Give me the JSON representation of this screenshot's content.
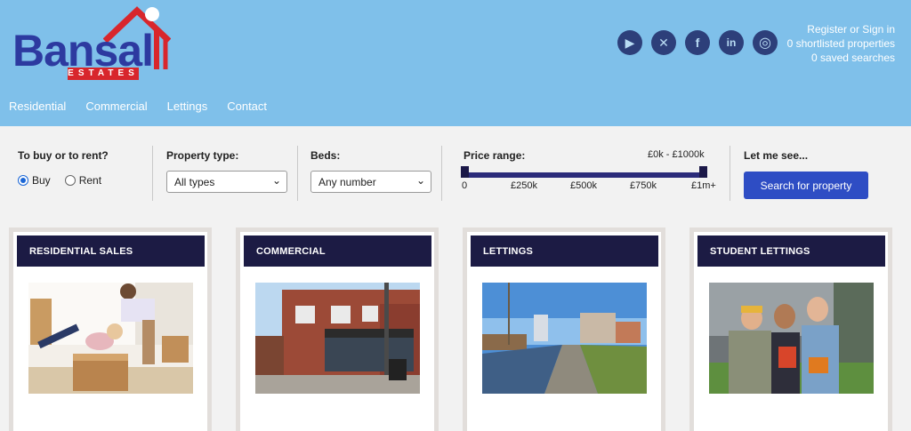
{
  "logo": {
    "wordmark": "Bansal",
    "subtitle": "ESTATES"
  },
  "social": [
    {
      "icon": "youtube-icon",
      "glyph": "▶"
    },
    {
      "icon": "x-icon",
      "glyph": "✕"
    },
    {
      "icon": "facebook-icon",
      "glyph": "f"
    },
    {
      "icon": "linkedin-icon",
      "glyph": "in"
    },
    {
      "icon": "instagram-icon",
      "glyph": "◎"
    }
  ],
  "account": {
    "register": "Register or Sign in",
    "shortlisted": "0 shortlisted properties",
    "saved": "0 saved searches"
  },
  "nav": [
    "Residential",
    "Commercial",
    "Lettings",
    "Contact"
  ],
  "search": {
    "buy_rent_label": "To buy or to rent?",
    "buy": "Buy",
    "rent": "Rent",
    "property_type_label": "Property type:",
    "property_type_value": "All types",
    "beds_label": "Beds:",
    "beds_value": "Any number",
    "price_label": "Price range:",
    "price_value": "£0k - £1000k",
    "ticks": [
      "0",
      "£250k",
      "£500k",
      "£750k",
      "£1m+"
    ],
    "let_me_see": "Let me see...",
    "button": "Search for property"
  },
  "cards": [
    {
      "title": "RESIDENTIAL SALES"
    },
    {
      "title": "COMMERCIAL"
    },
    {
      "title": "LETTINGS"
    },
    {
      "title": "STUDENT LETTINGS"
    }
  ],
  "colors": {
    "header": "#7fc0ea",
    "navy": "#1c1b44",
    "button": "#2e4dc4",
    "logo_blue": "#2d3aa0",
    "logo_red": "#d8262c"
  }
}
